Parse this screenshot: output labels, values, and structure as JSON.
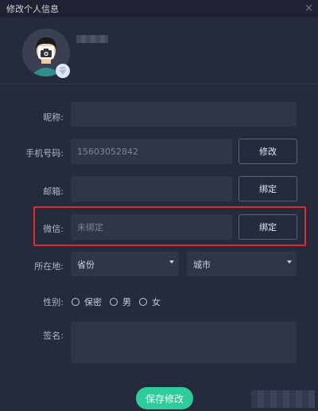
{
  "window": {
    "title": "修改个人信息",
    "close_glyph": "×"
  },
  "profile": {
    "avatar_icon": "avatar-icon",
    "camera_icon": "camera-icon",
    "badge_icon": "diamond-icon"
  },
  "form": {
    "nickname": {
      "label": "昵称:",
      "value": ""
    },
    "phone": {
      "label": "手机号码:",
      "value": "15603052842",
      "button": "修改"
    },
    "email": {
      "label": "邮箱:",
      "value": "",
      "button": "绑定"
    },
    "wechat": {
      "label": "微信:",
      "value": "未绑定",
      "button": "绑定"
    },
    "location": {
      "label": "所在地:",
      "province": "省份",
      "city": "城市"
    },
    "gender": {
      "label": "性别:",
      "options": [
        "保密",
        "男",
        "女"
      ]
    },
    "signature": {
      "label": "签名:",
      "value": ""
    }
  },
  "save_button": "保存修改",
  "colors": {
    "accent": "#2ecc9a",
    "highlight": "#e02c2c",
    "background": "#262a3d"
  }
}
